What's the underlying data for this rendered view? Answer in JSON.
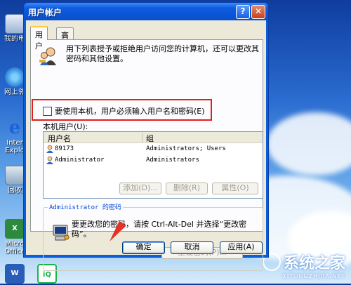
{
  "desktop": {
    "icons": [
      {
        "label": "我的电",
        "icon": "my-computer-icon"
      },
      {
        "label": "网上邻",
        "icon": "network-icon"
      },
      {
        "label": "Inter Explo",
        "icon": "internet-explorer-icon"
      },
      {
        "label": "回收",
        "icon": "recycle-bin-icon"
      },
      {
        "label": "Micro Office",
        "icon": "excel-icon"
      }
    ],
    "watermark": {
      "name": "系统之家",
      "url": "XITONGZHIJIA.NET"
    }
  },
  "window": {
    "title": "用户帐户",
    "tabs": [
      {
        "label": "用户",
        "active": true
      },
      {
        "label": "高级",
        "active": false
      }
    ],
    "description": "用下列表授予或拒绝用户访问您的计算机，还可以更改其密码和其他设置。",
    "checkbox": {
      "label": "要使用本机，用户必须输入用户名和密码(E)",
      "checked": false
    },
    "list_label": "本机用户(U):",
    "columns": [
      "用户名",
      "组"
    ],
    "users": [
      {
        "name": "89173",
        "group": "Administrators; Users"
      },
      {
        "name": "Administrator",
        "group": "Administrators"
      }
    ],
    "user_buttons": {
      "add": "添加(D)...",
      "remove": "删除(R)",
      "properties": "属性(O)"
    },
    "password_group": {
      "title": "Administrator 的密码",
      "text": "要更改您的密码，请按 Ctrl-Alt-Del 并选择“更改密码”。",
      "reset_button": "重设密码(P)..."
    },
    "footer": {
      "ok": "确定",
      "cancel": "取消",
      "apply": "应用(A)"
    }
  },
  "colors": {
    "highlight": "#e0201c",
    "titlebar": "#0a55d6",
    "link_blue": "#0046d5"
  }
}
